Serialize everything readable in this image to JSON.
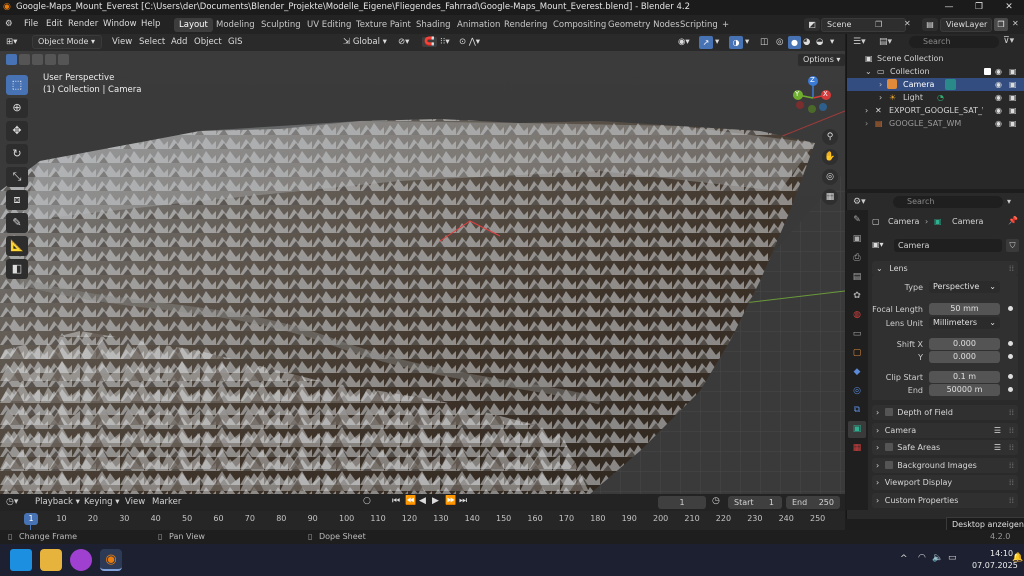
{
  "window": {
    "title": "Google-Maps_Mount_Everest [C:\\Users\\der\\Documents\\Blender_Projekte\\Modelle_Eigene\\Fliegendes_Fahrrad\\Google-Maps_Mount_Everest.blend] - Blender 4.2",
    "minimize": "—",
    "maximize": "❐",
    "close": "✕"
  },
  "menu": {
    "items": [
      "File",
      "Edit",
      "Render",
      "Window",
      "Help"
    ],
    "workspaces": [
      "Layout",
      "Modeling",
      "Sculpting",
      "UV Editing",
      "Texture Paint",
      "Shading",
      "Animation",
      "Rendering",
      "Compositing",
      "Geometry Nodes",
      "Scripting"
    ],
    "add_workspace": "+",
    "scene": "Scene",
    "view_layer": "ViewLayer"
  },
  "viewport_header": {
    "mode": "Object Mode",
    "menus": [
      "View",
      "Select",
      "Add",
      "Object",
      "GIS"
    ],
    "transform": "Global",
    "options": "Options"
  },
  "viewport": {
    "overlay_line1": "User Perspective",
    "overlay_line2": "(1) Collection | Camera",
    "gizmo_x": "X",
    "gizmo_y": "Y",
    "gizmo_z": "Z"
  },
  "outliner": {
    "search_placeholder": "Search",
    "scene_collection": "Scene Collection",
    "collection": "Collection",
    "camera": "Camera",
    "light": "Light",
    "export": "EXPORT_GOOGLE_SAT_W",
    "google": "GOOGLE_SAT_WM"
  },
  "properties": {
    "search_placeholder": "Search",
    "breadcrumb_object": "Camera",
    "breadcrumb_data": "Camera",
    "datablock": "Camera",
    "lens_header": "Lens",
    "type_label": "Type",
    "type_value": "Perspective",
    "focal_label": "Focal Length",
    "focal_value": "50 mm",
    "lens_unit_label": "Lens Unit",
    "lens_unit_value": "Millimeters",
    "shift_x_label": "Shift X",
    "shift_x_value": "0.000",
    "shift_y_label": "Y",
    "shift_y_value": "0.000",
    "clip_start_label": "Clip Start",
    "clip_start_value": "0.1 m",
    "clip_end_label": "End",
    "clip_end_value": "50000 m",
    "panels": [
      "Depth of Field",
      "Camera",
      "Safe Areas",
      "Background Images",
      "Viewport Display",
      "Custom Properties"
    ]
  },
  "timeline": {
    "menus": [
      "Playback",
      "Keying",
      "View",
      "Marker"
    ],
    "current_frame": "1",
    "start_label": "Start",
    "start_value": "1",
    "end_label": "End",
    "end_value": "250",
    "frame_marker": "1",
    "ticks": [
      "10",
      "20",
      "30",
      "40",
      "50",
      "60",
      "70",
      "80",
      "90",
      "100",
      "110",
      "120",
      "130",
      "140",
      "150",
      "160",
      "170",
      "180",
      "190",
      "200",
      "210",
      "220",
      "230",
      "240",
      "250"
    ]
  },
  "statusbar": {
    "change_frame": "Change Frame",
    "pan_view": "Pan View",
    "dope_sheet": "Dope Sheet",
    "version": "4.2.0",
    "tooltip": "Desktop anzeigen"
  },
  "taskbar": {
    "time": "14:10",
    "date": "07.07.2025",
    "tray_chevron": "^"
  }
}
